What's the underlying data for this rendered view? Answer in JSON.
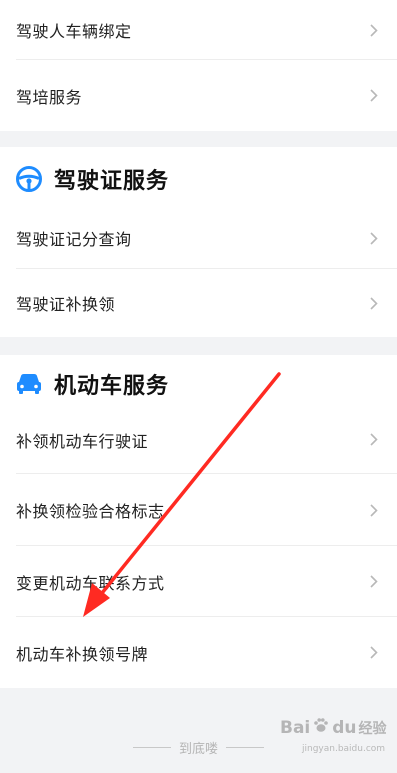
{
  "top_card": {
    "items": [
      {
        "label": "驾驶人车辆绑定"
      },
      {
        "label": "驾培服务"
      }
    ]
  },
  "license_section": {
    "title": "驾驶证服务",
    "icon": "steering-wheel-icon",
    "items": [
      {
        "label": "驾驶证记分查询"
      },
      {
        "label": "驾驶证补换领"
      }
    ]
  },
  "vehicle_section": {
    "title": "机动车服务",
    "icon": "car-icon",
    "items": [
      {
        "label": "补领机动车行驶证"
      },
      {
        "label": "补换领检验合格标志"
      },
      {
        "label": "变更机动车联系方式"
      },
      {
        "label": "机动车补换领号牌"
      }
    ]
  },
  "footer": {
    "text": "到底喽"
  },
  "watermark": {
    "brand_a": "Bai",
    "brand_b": "du",
    "sub": "经验",
    "url": "jingyan.baidu.com"
  },
  "colors": {
    "accent": "#1e8cff",
    "arrow": "#ff2a22"
  }
}
